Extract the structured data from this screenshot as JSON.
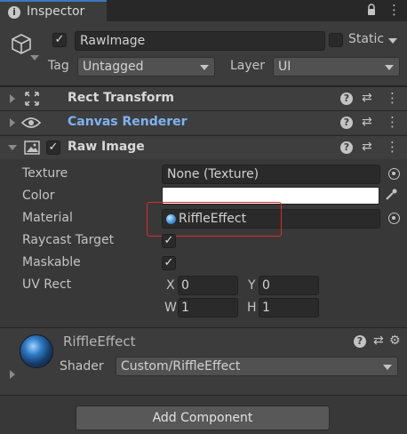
{
  "tab": {
    "title": "Inspector"
  },
  "header": {
    "enabled": true,
    "name": "RawImage",
    "static_label": "Static",
    "static_checked": false,
    "tag_label": "Tag",
    "tag_value": "Untagged",
    "layer_label": "Layer",
    "layer_value": "UI"
  },
  "components": {
    "rect_transform": {
      "title": "Rect Transform"
    },
    "canvas_renderer": {
      "title": "Canvas Renderer",
      "title_color": "#7fb2f0"
    },
    "raw_image": {
      "title": "Raw Image",
      "enabled": true
    }
  },
  "raw_image_fields": {
    "texture_label": "Texture",
    "texture_value": "None (Texture)",
    "color_label": "Color",
    "color_value": "#ffffff",
    "material_label": "Material",
    "material_value": "RiffleEffect",
    "raycast_label": "Raycast Target",
    "raycast_checked": true,
    "maskable_label": "Maskable",
    "maskable_checked": true,
    "uvrect_label": "UV Rect",
    "x_label": "X",
    "x_value": "0",
    "y_label": "Y",
    "y_value": "0",
    "w_label": "W",
    "w_value": "1",
    "h_label": "H",
    "h_value": "1"
  },
  "material": {
    "name": "RiffleEffect",
    "shader_label": "Shader",
    "shader_value": "Custom/RiffleEffect"
  },
  "footer": {
    "add_component_label": "Add Component"
  },
  "colors": {
    "highlight": "#e02a2a",
    "accent": "#3a79bb"
  }
}
